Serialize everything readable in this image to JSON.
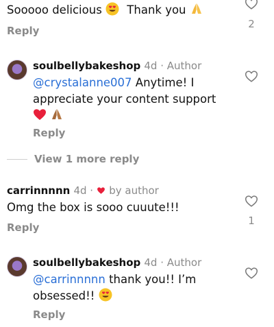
{
  "comments": [
    {
      "text": "Sooooo delicious",
      "text2": "Thank you",
      "reply_label": "Reply",
      "like_count": "2"
    },
    {
      "username": "soulbellybakeshop",
      "meta": "4d · Author",
      "mention": "@crystalanne007",
      "text_a": " Anytime! I",
      "text_b": "appreciate your content support",
      "reply_label": "Reply"
    },
    {
      "view_more": "View 1 more reply"
    },
    {
      "username": "carrinnnnn",
      "time": "4d ·",
      "by_author": "by author",
      "text": "Omg the box is sooo cuuute!!!",
      "reply_label": "Reply",
      "like_count": "1"
    },
    {
      "username": "soulbellybakeshop",
      "meta": "4d · Author",
      "mention": "@carrinnnnn",
      "text_a": " thank you!! I’m",
      "text_b": "obsessed!!",
      "reply_label": "Reply"
    }
  ],
  "icons": {
    "like": "heart-outline-icon",
    "author_like": "red-heart-icon",
    "emoji_heart_eyes": "heart-eyes-emoji-icon",
    "emoji_pray": "praying-hands-emoji-icon",
    "emoji_red_heart": "red-heart-emoji-icon"
  },
  "colors": {
    "mention": "#2a6fd6",
    "secondary": "#8a8a8a",
    "heart_red": "#e8203b"
  }
}
